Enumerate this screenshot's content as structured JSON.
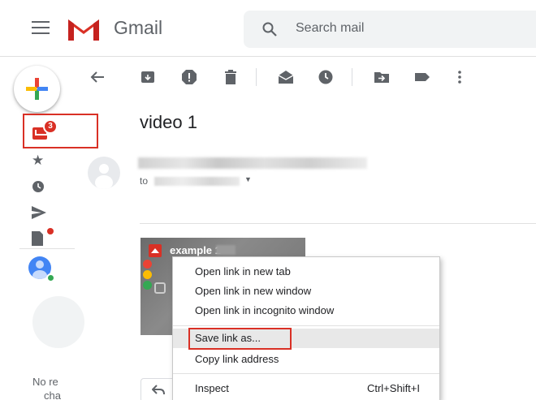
{
  "app": {
    "name": "Gmail",
    "brand_color": "#d93025"
  },
  "search": {
    "placeholder": "Search mail"
  },
  "sidebar": {
    "inbox_badge": "3",
    "no_recent_text": [
      "No re",
      "cha"
    ],
    "icons": [
      "inbox-icon",
      "star-icon",
      "clock-icon",
      "send-icon",
      "draft-icon"
    ]
  },
  "email": {
    "subject": "video 1",
    "to_label": "to",
    "attachment_name": "example 1"
  },
  "context_menu": {
    "items": [
      {
        "label": "Open link in new tab"
      },
      {
        "label": "Open link in new window"
      },
      {
        "label": "Open link in incognito window"
      },
      {
        "label": "Save link as..."
      },
      {
        "label": "Copy link address"
      },
      {
        "label": "Inspect",
        "shortcut": "Ctrl+Shift+I"
      }
    ]
  }
}
